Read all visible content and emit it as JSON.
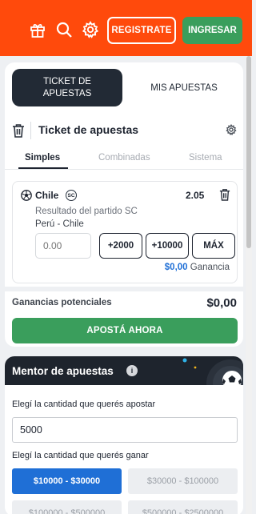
{
  "header": {
    "icons": [
      "gift-icon",
      "search-icon",
      "gear-icon"
    ],
    "register_label": "REGISTRATE",
    "login_label": "INGRESAR",
    "colors": {
      "bar": "#ff4a0c",
      "login": "#3a9e5c"
    }
  },
  "ticket": {
    "tabs": {
      "ticket_line1": "TICKET DE",
      "ticket_line2": "APUESTAS",
      "mis": "MIS APUESTAS"
    },
    "title": "Ticket de apuestas",
    "bet_types": [
      "Simples",
      "Combinadas",
      "Sistema"
    ],
    "bet": {
      "selection": "Chile",
      "badge": "SC",
      "odds": "2.05",
      "market": "Resultado del partido SC",
      "match": "Perú - Chile",
      "stake_placeholder": "0.00",
      "quick_stakes": [
        "+2000",
        "+10000",
        "MÁX"
      ],
      "gain_amount": "$0,00",
      "gain_label": "Ganancia"
    },
    "potential_label": "Ganancias potenciales",
    "potential_value": "$0,00",
    "place_bet_label": "APOSTÁ AHORA"
  },
  "mentor": {
    "title": "Mentor de apuestas",
    "info_icon": "i",
    "amount_label": "Elegí la cantidad que querés apostar",
    "amount_value": "5000",
    "win_label": "Elegí la cantidad que querés ganar",
    "ranges": [
      "$10000 - $30000",
      "$30000 - $100000",
      "$100000 - $500000",
      "$500000 - $2500000"
    ],
    "selected_range": 0
  }
}
